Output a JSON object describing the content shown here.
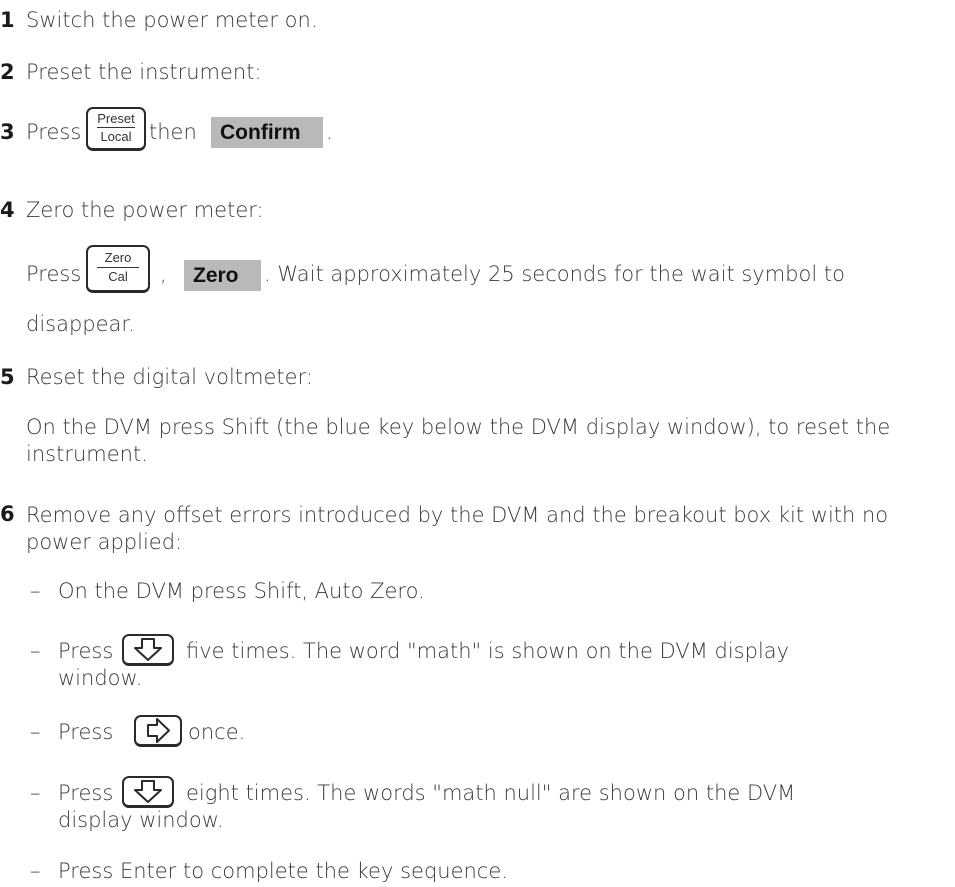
{
  "steps": [
    {
      "num": "1",
      "text": "Switch the power meter on."
    },
    {
      "num": "2",
      "text": "Preset the instrument:"
    },
    {
      "num": "3",
      "press": "Press",
      "key_top": "Preset",
      "key_bottom": "Local",
      "then": "then",
      "softkey": "Confirm",
      "end": "."
    },
    {
      "num": "4",
      "text": "Zero the power meter:",
      "sub_press": "Press",
      "key_top": "Zero",
      "key_bottom": "Cal",
      "comma": ",",
      "softkey": "Zero",
      "sub_text": ". Wait approximately 25 seconds for the wait symbol to",
      "sub_text2": "disappear."
    },
    {
      "num": "5",
      "text": "Reset the digital voltmeter:",
      "sub_text": "On the DVM press Shift (the blue key below the DVM display window), to reset the instrument."
    },
    {
      "num": "6",
      "text": "Remove any offset errors introduced by the DVM and the breakout box kit with no power applied:",
      "bullets": [
        {
          "dash": "–",
          "text": "On the DVM press Shift, Auto Zero."
        },
        {
          "dash": "–",
          "press": "Press",
          "icon": "down-arrow-key-icon",
          "text": "five times. The word \"math\" is shown on the DVM display",
          "text2": "window."
        },
        {
          "dash": "–",
          "press": "Press",
          "icon": "right-arrow-key-icon",
          "text": "once."
        },
        {
          "dash": "–",
          "press": "Press",
          "icon": "down-arrow-key-icon",
          "text": "eight times. The words \"math null\" are shown on the DVM",
          "text2": "display window."
        },
        {
          "dash": "–",
          "text": "Press Enter to complete the key sequence."
        }
      ]
    }
  ]
}
